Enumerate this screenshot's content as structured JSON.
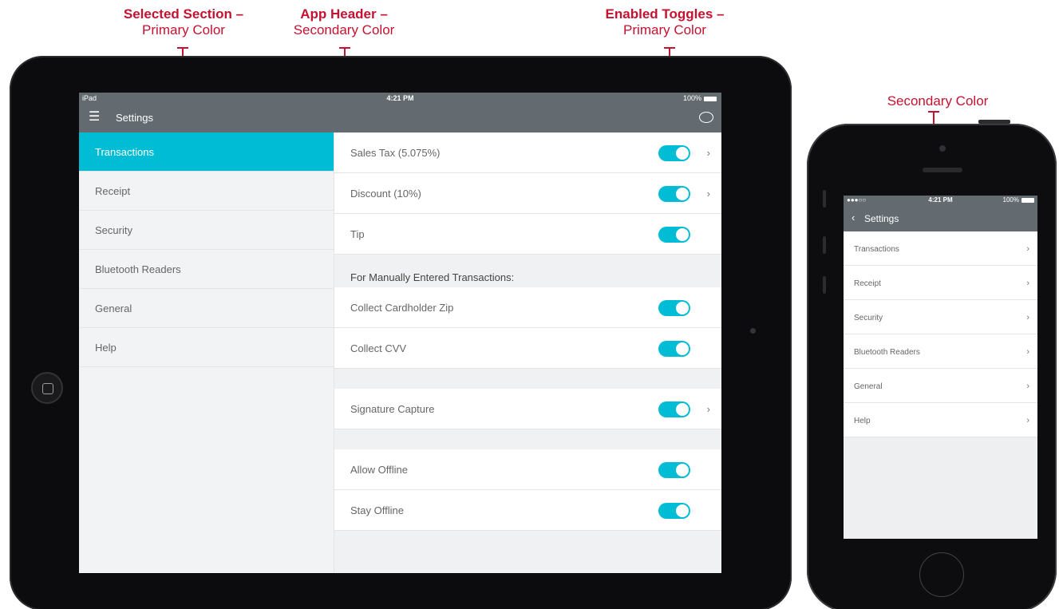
{
  "annotations": {
    "selected_section": {
      "title": "Selected Section –",
      "sub": "Primary Color"
    },
    "app_header": {
      "title": "App Header –",
      "sub": "Secondary Color"
    },
    "enabled_toggles": {
      "title": "Enabled Toggles –",
      "sub": "Primary Color"
    },
    "phone_secondary": {
      "sub": "Secondary Color"
    }
  },
  "colors": {
    "primary": "#00bcd4",
    "secondary": "#636b71",
    "annotation": "#c41230"
  },
  "ipad": {
    "status": {
      "device": "iPad",
      "time": "4:21 PM",
      "battery": "100%"
    },
    "header": {
      "menu_icon": "menu-icon",
      "title": "Settings",
      "chat_icon": "chat-bubble-icon"
    },
    "sidebar": {
      "items": [
        {
          "label": "Transactions",
          "selected": true
        },
        {
          "label": "Receipt"
        },
        {
          "label": "Security"
        },
        {
          "label": "Bluetooth Readers"
        },
        {
          "label": "General"
        },
        {
          "label": "Help"
        }
      ]
    },
    "content": {
      "group1": [
        {
          "label": "Sales Tax (5.075%)",
          "enabled": true,
          "chevron": "›"
        },
        {
          "label": "Discount (10%)",
          "enabled": true,
          "chevron": "›"
        },
        {
          "label": "Tip",
          "enabled": true
        }
      ],
      "manual_heading": "For Manually  Entered Transactions:",
      "group2": [
        {
          "label": "Collect Cardholder Zip",
          "enabled": true
        },
        {
          "label": "Collect CVV",
          "enabled": true
        }
      ],
      "group3": [
        {
          "label": "Signature Capture",
          "enabled": true,
          "chevron": "›"
        }
      ],
      "group4": [
        {
          "label": "Allow Offline",
          "enabled": true
        },
        {
          "label": "Stay Offline",
          "enabled": true
        }
      ]
    }
  },
  "iphone": {
    "status": {
      "signal": "●●●○○",
      "time": "4:21 PM",
      "battery": "100%"
    },
    "header": {
      "back": "‹",
      "title": "Settings"
    },
    "items": [
      {
        "label": "Transactions",
        "chevron": "›"
      },
      {
        "label": "Receipt",
        "chevron": "›"
      },
      {
        "label": "Security",
        "chevron": "›"
      },
      {
        "label": "Bluetooth Readers",
        "chevron": "›"
      },
      {
        "label": "General",
        "chevron": "›"
      },
      {
        "label": "Help",
        "chevron": "›"
      }
    ]
  }
}
